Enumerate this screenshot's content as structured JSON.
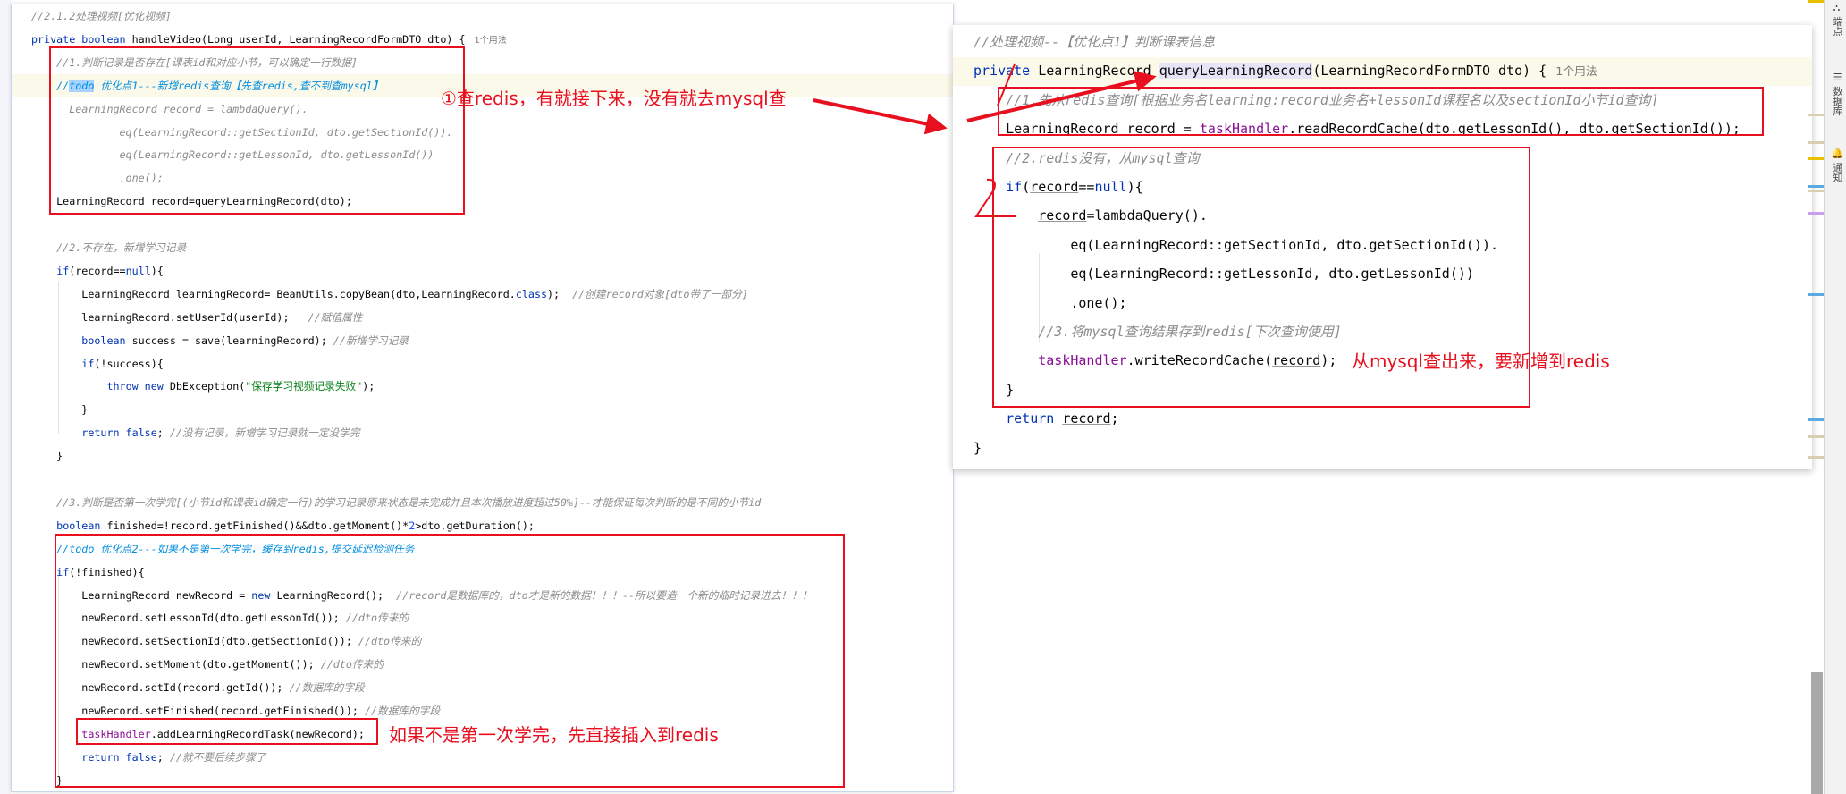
{
  "colors": {
    "annotation": "#e8101e",
    "keyword": "#0033b3",
    "comment": "#8c8c8c",
    "field": "#871094",
    "string": "#067d17"
  },
  "left_editor": {
    "lines": [
      [
        [
          "//2.1.2处理视频[优化视频]",
          "cm"
        ]
      ],
      [
        [
          "private boolean ",
          "kw"
        ],
        [
          "handleVideo(Long userId, LearningRecordFormDTO dto) {",
          "pl"
        ],
        [
          "1个用法",
          "hint"
        ]
      ],
      [
        [
          "    //1.判断记录是否存在[课表id和对应小节，可以确定一行数据]",
          "cm"
        ]
      ],
      [
        [
          "    //",
          "todo"
        ],
        [
          "todo",
          "todo sel"
        ],
        [
          " 优化点1---新增redis查询【先查redis,查不到查mysql】",
          "todo"
        ]
      ],
      [
        [
          "      LearningRecord record = lambdaQuery().",
          "cm"
        ]
      ],
      [
        [
          "              eq(LearningRecord::getSectionId, dto.getSectionId()).",
          "cm"
        ]
      ],
      [
        [
          "              eq(LearningRecord::getLessonId, dto.getLessonId())",
          "cm"
        ]
      ],
      [
        [
          "              .one();",
          "cm"
        ]
      ],
      [
        [
          "    LearningRecord record=queryLearningRecord(dto);",
          "pl"
        ]
      ],
      [],
      [
        [
          "    //2.不存在，新增学习记录",
          "cm"
        ]
      ],
      [
        [
          "    ",
          "pl"
        ],
        [
          "if",
          "kw"
        ],
        [
          "(record==",
          "pl"
        ],
        [
          "null",
          "kw"
        ],
        [
          "){",
          "pl"
        ]
      ],
      [
        [
          "        LearningRecord learningRecord= BeanUtils.",
          "pl"
        ],
        [
          "copyBean",
          "pl"
        ],
        [
          "(dto,LearningRecord.",
          "pl"
        ],
        [
          "class",
          "kw"
        ],
        [
          ");  ",
          "pl"
        ],
        [
          "//创建record对象[dto带了一部分]",
          "cm"
        ]
      ],
      [
        [
          "        learningRecord.setUserId(userId);   ",
          "pl"
        ],
        [
          "//赋值属性",
          "cm"
        ]
      ],
      [
        [
          "        ",
          "pl"
        ],
        [
          "boolean",
          "kw"
        ],
        [
          " success = save(learningRecord); ",
          "pl"
        ],
        [
          "//新增学习记录",
          "cm"
        ]
      ],
      [
        [
          "        ",
          "pl"
        ],
        [
          "if",
          "kw"
        ],
        [
          "(!success){",
          "pl"
        ]
      ],
      [
        [
          "            ",
          "pl"
        ],
        [
          "throw new",
          "kw"
        ],
        [
          " DbException(",
          "pl"
        ],
        [
          "\"保存学习视频记录失败\"",
          "str"
        ],
        [
          ");",
          "pl"
        ]
      ],
      [
        [
          "        }",
          "pl"
        ]
      ],
      [
        [
          "        ",
          "pl"
        ],
        [
          "return false",
          "kw"
        ],
        [
          "; ",
          "pl"
        ],
        [
          "//没有记录，新增学习记录就一定没学完",
          "cm"
        ]
      ],
      [
        [
          "    }",
          "pl"
        ]
      ],
      [],
      [
        [
          "    //3.判断是否第一次学完[(小节id和课表id确定一行)的学习记录原来状态是未完成并且本次播放进度超过50%]--才能保证每次判断的是不同的小节id",
          "cm"
        ]
      ],
      [
        [
          "    ",
          "pl"
        ],
        [
          "boolean",
          "kw"
        ],
        [
          " finished=!record.getFinished()&&dto.getMoment()*",
          "pl"
        ],
        [
          "2",
          "num"
        ],
        [
          ">dto.getDuration();",
          "pl"
        ]
      ],
      [
        [
          "    //todo 优化点2---如果不是第一次学完，缓存到redis,提交延迟检测任务",
          "todo"
        ]
      ],
      [
        [
          "    ",
          "pl"
        ],
        [
          "if",
          "kw"
        ],
        [
          "(!finished){",
          "pl"
        ]
      ],
      [
        [
          "        LearningRecord newRecord = ",
          "pl"
        ],
        [
          "new",
          "kw"
        ],
        [
          " LearningRecord();  ",
          "pl"
        ],
        [
          "//record是数据库的，dto才是新的数据！！！--所以要造一个新的临时记录进去！！！",
          "cm"
        ]
      ],
      [
        [
          "        newRecord.setLessonId(dto.getLessonId()); ",
          "pl"
        ],
        [
          "//dto传来的",
          "cm"
        ]
      ],
      [
        [
          "        newRecord.setSectionId(dto.getSectionId()); ",
          "pl"
        ],
        [
          "//dto传来的",
          "cm"
        ]
      ],
      [
        [
          "        newRecord.setMoment(dto.getMoment()); ",
          "pl"
        ],
        [
          "//dto传来的",
          "cm"
        ]
      ],
      [
        [
          "        newRecord.setId(record.getId()); ",
          "pl"
        ],
        [
          "//数据库的字段",
          "cm"
        ]
      ],
      [
        [
          "        newRecord.setFinished(record.getFinished()); ",
          "pl"
        ],
        [
          "//数据库的字段",
          "cm"
        ]
      ],
      [
        [
          "        ",
          "pl"
        ],
        [
          "taskHandler",
          "fld"
        ],
        [
          ".addLearningRecordTask(newRecord);",
          "pl"
        ]
      ],
      [
        [
          "        ",
          "pl"
        ],
        [
          "return false",
          "kw"
        ],
        [
          "; ",
          "pl"
        ],
        [
          "//就不要后续步骤了",
          "cm"
        ]
      ],
      [
        [
          "    }",
          "pl"
        ]
      ]
    ]
  },
  "right_editor": {
    "lines": [
      [
        [
          "//处理视频--【优化点1】判断课表信息",
          "cm"
        ]
      ],
      [
        [
          "private ",
          "kw"
        ],
        [
          "LearningRecord ",
          "pl"
        ],
        [
          "queryLearningRecord",
          "pl usage"
        ],
        [
          "(LearningRecordFormDTO dto) {",
          "pl"
        ],
        [
          "1个用法",
          "hint"
        ]
      ],
      [
        [
          "    //1.先从redis查询[根据业务名learning:record业务名+lessonId课程名以及sectionId小节id查询]",
          "cm"
        ]
      ],
      [
        [
          "    LearningRecord ",
          "pl"
        ],
        [
          "record",
          "pl ul"
        ],
        [
          " = ",
          "pl"
        ],
        [
          "taskHandler",
          "fld"
        ],
        [
          ".readRecordCache(dto.getLessonId(), dto.getSectionId());",
          "pl"
        ]
      ],
      [
        [
          "    //2.redis没有，从mysql查询",
          "cm"
        ]
      ],
      [
        [
          "    ",
          "pl"
        ],
        [
          "if",
          "kw"
        ],
        [
          "(",
          "pl"
        ],
        [
          "record",
          "pl ul"
        ],
        [
          "==",
          "pl"
        ],
        [
          "null",
          "kw"
        ],
        [
          "){",
          "pl"
        ]
      ],
      [
        [
          "        ",
          "pl"
        ],
        [
          "record",
          "pl ul"
        ],
        [
          "=lambdaQuery().",
          "pl"
        ]
      ],
      [
        [
          "            eq(LearningRecord::getSectionId, dto.getSectionId()).",
          "pl"
        ]
      ],
      [
        [
          "            eq(LearningRecord::getLessonId, dto.getLessonId())",
          "pl"
        ]
      ],
      [
        [
          "            .one();",
          "pl"
        ]
      ],
      [
        [
          "        //3.将mysql查询结果存到redis[下次查询使用]",
          "cm"
        ]
      ],
      [
        [
          "        ",
          "pl"
        ],
        [
          "taskHandler",
          "fld"
        ],
        [
          ".writeRecordCache(",
          "pl"
        ],
        [
          "record",
          "pl ul"
        ],
        [
          ");",
          "pl"
        ]
      ],
      [
        [
          "    }",
          "pl"
        ]
      ],
      [
        [
          "    ",
          "pl"
        ],
        [
          "return",
          "kw"
        ],
        [
          " ",
          "pl"
        ],
        [
          "record",
          "pl ul"
        ],
        [
          ";",
          "pl"
        ]
      ],
      [
        [
          "}",
          "pl"
        ]
      ]
    ]
  },
  "annotations": {
    "redis_first": "①查redis，有就接下来，没有就去mysql查",
    "insert_redis": "如果不是第一次学完，先直接插入到redis",
    "mysql_to_redis": "从mysql查出来，要新增到redis"
  },
  "sidebar": {
    "items": [
      {
        "label": "端点",
        "icon": "endpoints-icon"
      },
      {
        "label": "数据库",
        "icon": "database-icon"
      },
      {
        "label": "通知",
        "icon": "notifications-icon"
      }
    ]
  }
}
